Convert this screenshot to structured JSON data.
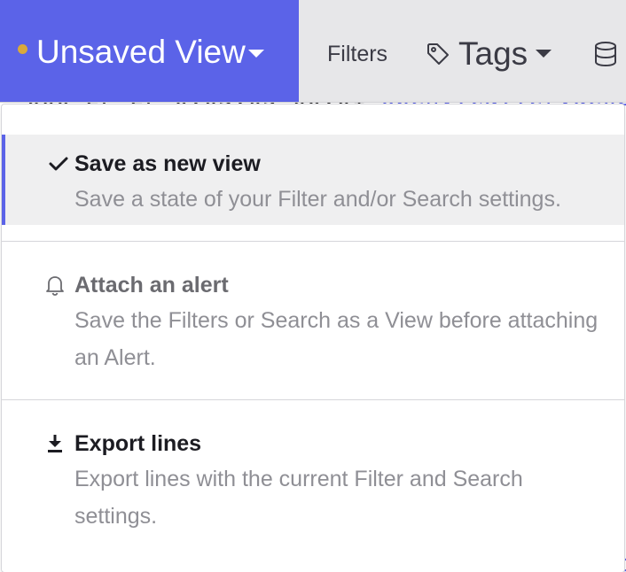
{
  "toolbar": {
    "view_title": "Unsaved View",
    "filters_label": "Filters",
    "tags_label": "Tags",
    "icons": [
      "chevron-down-icon",
      "tag-icon",
      "database-icon"
    ],
    "colors": {
      "accent": "#5b63e8",
      "unsaved_dot": "#d9a93b",
      "toolbar_bg": "#e7e7e9"
    }
  },
  "menu": {
    "items": [
      {
        "icon": "checkmark-icon",
        "title": "Save as new view",
        "description": "Save a state of your Filter and/or Search settings.",
        "state": "highlighted"
      },
      {
        "icon": "bell-icon",
        "title": "Attach an alert",
        "description": "Save the Filters or Search as a View before attaching an Alert.",
        "state": "disabled"
      },
      {
        "icon": "download-icon",
        "title": "Export lines",
        "description": "Export lines with the current Filter and Search settings.",
        "state": "enabled"
      }
    ]
  }
}
